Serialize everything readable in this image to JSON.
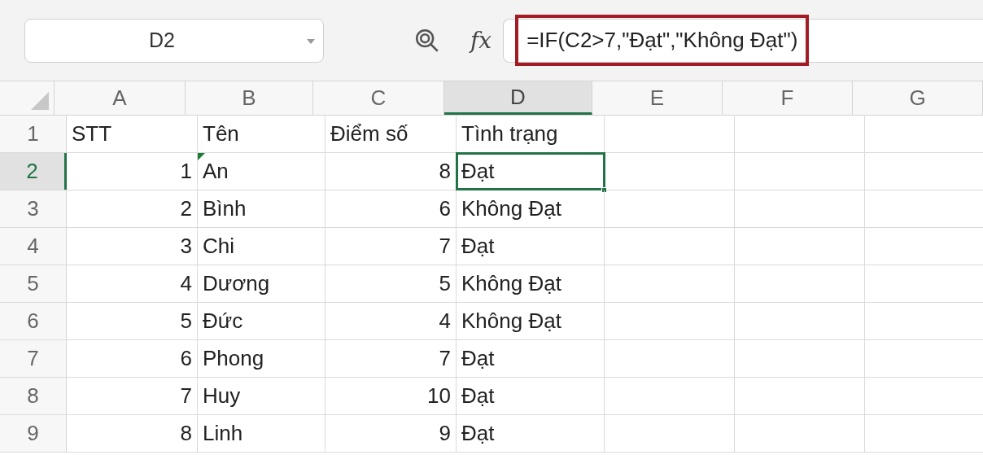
{
  "name_box": {
    "value": "D2"
  },
  "function_label": "fx",
  "formula": {
    "value": "=IF(C2>7,\"Đạt\",\"Không Đạt\")",
    "highlighted": true
  },
  "columns": [
    {
      "label": "A",
      "selected": false
    },
    {
      "label": "B",
      "selected": false
    },
    {
      "label": "C",
      "selected": false
    },
    {
      "label": "D",
      "selected": true
    },
    {
      "label": "E",
      "selected": false
    },
    {
      "label": "F",
      "selected": false
    },
    {
      "label": "G",
      "selected": false
    }
  ],
  "rows": [
    {
      "label": "1",
      "selected": false,
      "cells": [
        {
          "text": "STT",
          "kind": "text",
          "flag": false
        },
        {
          "text": "Tên",
          "kind": "text",
          "flag": false
        },
        {
          "text": "Điểm số",
          "kind": "text",
          "flag": false
        },
        {
          "text": "Tình trạng",
          "kind": "text",
          "flag": false
        }
      ]
    },
    {
      "label": "2",
      "selected": true,
      "cells": [
        {
          "text": "1",
          "kind": "number",
          "flag": false
        },
        {
          "text": "An",
          "kind": "text",
          "flag": true
        },
        {
          "text": "8",
          "kind": "number",
          "flag": false
        },
        {
          "text": "Đạt",
          "kind": "text",
          "flag": false
        }
      ]
    },
    {
      "label": "3",
      "selected": false,
      "cells": [
        {
          "text": "2",
          "kind": "number",
          "flag": false
        },
        {
          "text": "Bình",
          "kind": "text",
          "flag": false
        },
        {
          "text": "6",
          "kind": "number",
          "flag": false
        },
        {
          "text": "Không Đạt",
          "kind": "text",
          "flag": false
        }
      ]
    },
    {
      "label": "4",
      "selected": false,
      "cells": [
        {
          "text": "3",
          "kind": "number",
          "flag": false
        },
        {
          "text": "Chi",
          "kind": "text",
          "flag": false
        },
        {
          "text": "7",
          "kind": "number",
          "flag": false
        },
        {
          "text": "Đạt",
          "kind": "text",
          "flag": false
        }
      ]
    },
    {
      "label": "5",
      "selected": false,
      "cells": [
        {
          "text": "4",
          "kind": "number",
          "flag": false
        },
        {
          "text": "Dương",
          "kind": "text",
          "flag": false
        },
        {
          "text": "5",
          "kind": "number",
          "flag": false
        },
        {
          "text": "Không Đạt",
          "kind": "text",
          "flag": false
        }
      ]
    },
    {
      "label": "6",
      "selected": false,
      "cells": [
        {
          "text": "5",
          "kind": "number",
          "flag": false
        },
        {
          "text": "Đức",
          "kind": "text",
          "flag": false
        },
        {
          "text": "4",
          "kind": "number",
          "flag": false
        },
        {
          "text": "Không Đạt",
          "kind": "text",
          "flag": false
        }
      ]
    },
    {
      "label": "7",
      "selected": false,
      "cells": [
        {
          "text": "6",
          "kind": "number",
          "flag": false
        },
        {
          "text": "Phong",
          "kind": "text",
          "flag": false
        },
        {
          "text": "7",
          "kind": "number",
          "flag": false
        },
        {
          "text": "Đạt",
          "kind": "text",
          "flag": false
        }
      ]
    },
    {
      "label": "8",
      "selected": false,
      "cells": [
        {
          "text": "7",
          "kind": "number",
          "flag": false
        },
        {
          "text": "Huy",
          "kind": "text",
          "flag": false
        },
        {
          "text": "10",
          "kind": "number",
          "flag": false
        },
        {
          "text": "Đạt",
          "kind": "text",
          "flag": false
        }
      ]
    },
    {
      "label": "9",
      "selected": false,
      "cells": [
        {
          "text": "8",
          "kind": "number",
          "flag": false
        },
        {
          "text": "Linh",
          "kind": "text",
          "flag": false
        },
        {
          "text": "9",
          "kind": "number",
          "flag": false
        },
        {
          "text": "Đạt",
          "kind": "text",
          "flag": false
        }
      ]
    }
  ]
}
